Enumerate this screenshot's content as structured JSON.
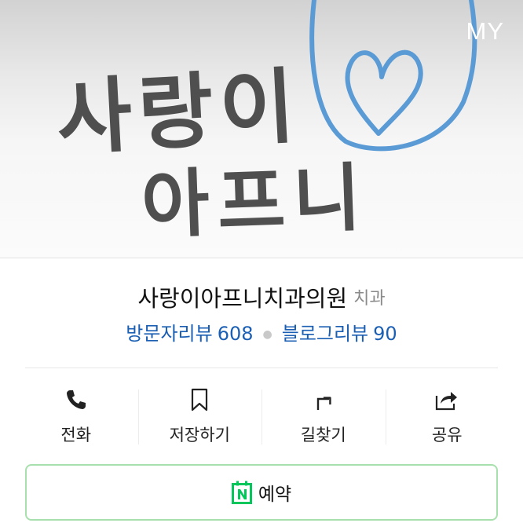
{
  "header": {
    "my_label": "MY",
    "hero_text_line1": "사랑이",
    "hero_text_line2": "아프니"
  },
  "place": {
    "name": "사랑이아프니치과의원",
    "category": "치과",
    "visitor_review_label": "방문자리뷰",
    "visitor_review_count": "608",
    "blog_review_label": "블로그리뷰",
    "blog_review_count": "90"
  },
  "actions": [
    {
      "label": "전화",
      "icon": "phone-icon"
    },
    {
      "label": "저장하기",
      "icon": "bookmark-icon"
    },
    {
      "label": "길찾기",
      "icon": "directions-icon"
    },
    {
      "label": "공유",
      "icon": "share-icon"
    }
  ],
  "reservation": {
    "label": "예약",
    "icon": "naver-calendar-icon"
  },
  "colors": {
    "accent_blue": "#1a5fb4",
    "heart_blue": "#5b9bd5",
    "reserve_green": "#03c75a",
    "reserve_border": "#a7e0ad",
    "hero_text": "#4f4f4f"
  }
}
